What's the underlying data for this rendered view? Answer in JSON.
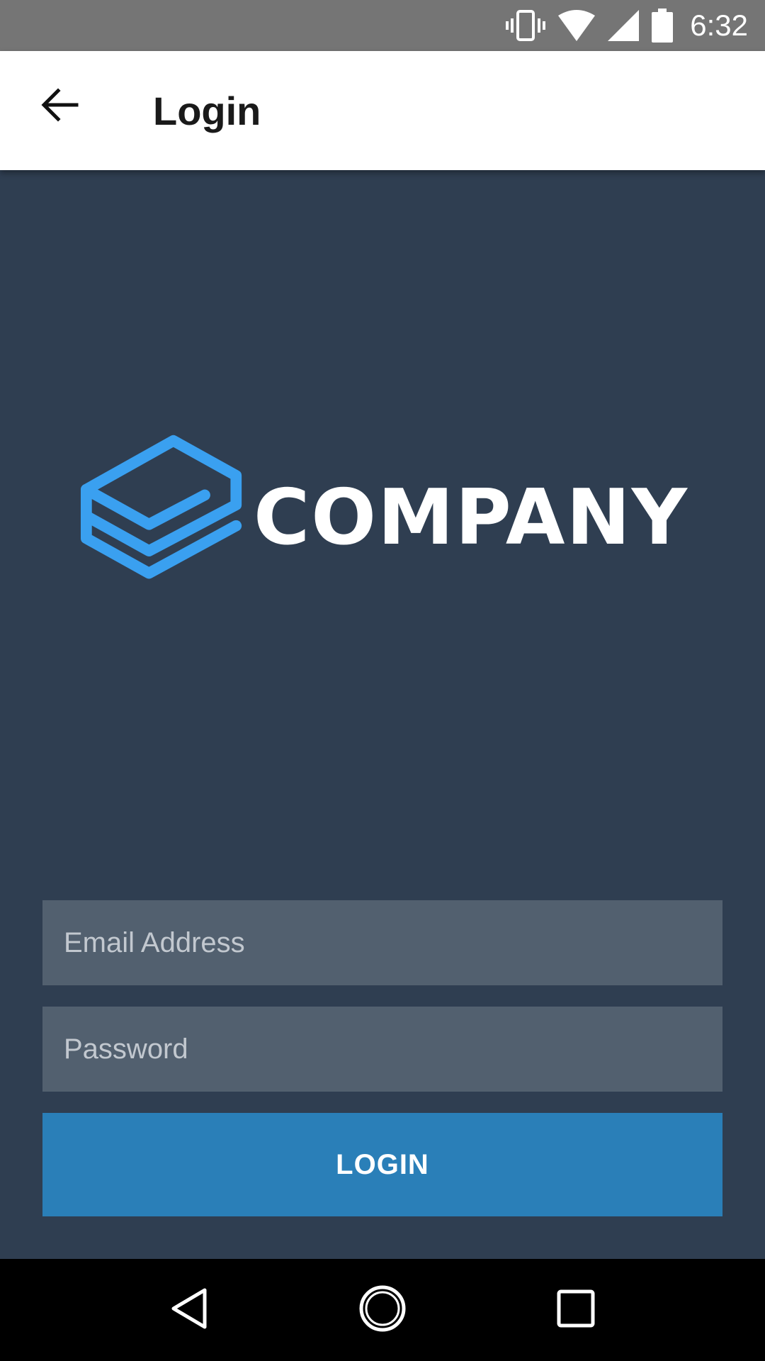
{
  "status_bar": {
    "time": "6:32",
    "icons": [
      "vibrate-icon",
      "wifi-icon",
      "signal-icon",
      "battery-icon"
    ]
  },
  "app_bar": {
    "title": "Login",
    "back_icon": "arrow-back-icon"
  },
  "logo": {
    "text": "COMPANY",
    "mark_color": "#3aa0f0"
  },
  "form": {
    "email_placeholder": "Email Address",
    "password_placeholder": "Password",
    "login_label": "LOGIN"
  },
  "nav_bar": {
    "icons": [
      "nav-back-icon",
      "nav-home-icon",
      "nav-recents-icon"
    ]
  },
  "colors": {
    "background": "#2f3e51",
    "field": "#52606f",
    "button": "#2a7fb8",
    "status_bar": "#757575",
    "app_bar": "#ffffff"
  }
}
